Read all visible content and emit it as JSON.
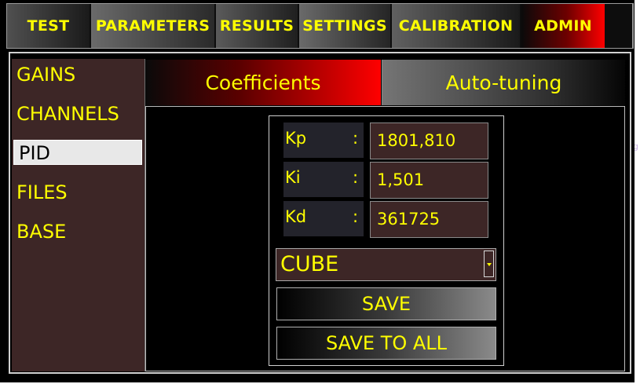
{
  "menu": {
    "items": [
      {
        "label": "TEST"
      },
      {
        "label": "PARAMETERS"
      },
      {
        "label": "RESULTS"
      },
      {
        "label": "SETTINGS"
      },
      {
        "label": "CALIBRATION"
      },
      {
        "label": "ADMIN",
        "active": true
      }
    ]
  },
  "sidebar": {
    "items": [
      {
        "label": "GAINS"
      },
      {
        "label": "CHANNELS"
      },
      {
        "label": "PID",
        "active": true
      },
      {
        "label": "FILES"
      },
      {
        "label": "BASE"
      }
    ]
  },
  "tabs": [
    {
      "label": "Coefficients",
      "active": true
    },
    {
      "label": "Auto-tuning"
    }
  ],
  "pid": {
    "kp": {
      "label": "Kp",
      "sep": ":",
      "value": "1801,810"
    },
    "ki": {
      "label": "Ki",
      "sep": ":",
      "value": "1,501"
    },
    "kd": {
      "label": "Kd",
      "sep": ":",
      "value": "361725"
    }
  },
  "mode_select": {
    "selected": "CUBE"
  },
  "buttons": {
    "save": "SAVE",
    "save_all": "SAVE TO ALL"
  },
  "colors": {
    "text": "#ffff00",
    "accent": "#ff0000",
    "panel": "#3d2626"
  }
}
